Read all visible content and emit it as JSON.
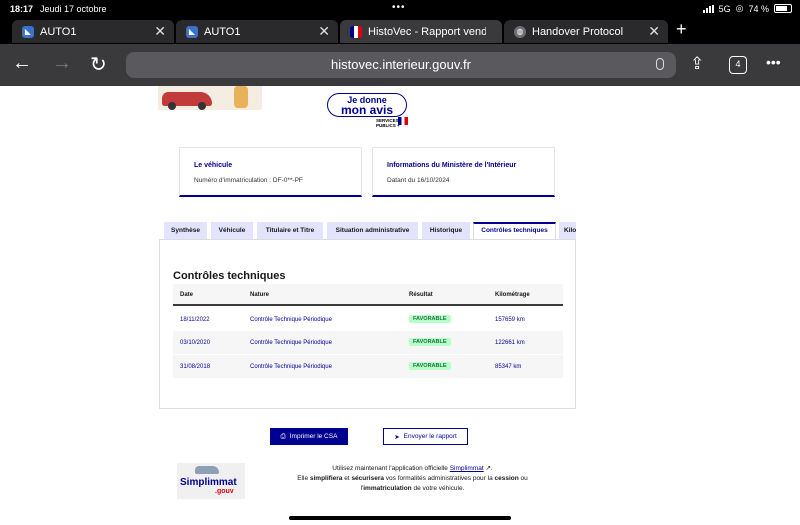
{
  "status": {
    "time": "18:17",
    "date": "Jeudi 17 octobre",
    "network": "5G",
    "battery": "74 %"
  },
  "browser_tabs": [
    {
      "title": "AUTO1",
      "icon": "auto1-favicon",
      "color": "#3b73c9"
    },
    {
      "title": "AUTO1",
      "icon": "auto1-favicon",
      "color": "#3b73c9"
    },
    {
      "title": "HistoVec - Rapport vendeur",
      "icon": "french-flag-favicon",
      "color": "#000091"
    },
    {
      "title": "Handover Protocol",
      "icon": "globe-icon",
      "color": "#6e6e73"
    }
  ],
  "toolbar": {
    "url": "histovec.interieur.gouv.fr",
    "tab_count": "4"
  },
  "banner": {
    "avis_line1": "Je donne",
    "avis_line2": "mon avis",
    "services_publics": "SERVICES PUBLICS +"
  },
  "cards": [
    {
      "title": "Le véhicule",
      "value": "Numéro d'immatriculation : DF-0**-PF"
    },
    {
      "title": "Informations du Ministère de l'Intérieur",
      "value": "Datant du 16/10/2024"
    }
  ],
  "page_tabs": [
    "Synthèse",
    "Véhicule",
    "Titulaire et Titre",
    "Situation administrative",
    "Historique",
    "Contrôles techniques",
    "Kilométrage"
  ],
  "active_tab": "Contrôles techniques",
  "section": {
    "title": "Contrôles techniques",
    "columns": [
      "Date",
      "Nature",
      "Résultat",
      "Kilométrage"
    ],
    "rows": [
      {
        "date": "18/11/2022",
        "nature": "Contrôle Technique Périodique",
        "result": "FAVORABLE",
        "km": "157659 km"
      },
      {
        "date": "03/10/2020",
        "nature": "Contrôle Technique Périodique",
        "result": "FAVORABLE",
        "km": "122661 km"
      },
      {
        "date": "31/08/2018",
        "nature": "Contrôle Technique Périodique",
        "result": "FAVORABLE",
        "km": "85347 km"
      }
    ]
  },
  "actions": {
    "print_label": "Imprimer le CSA",
    "send_label": "Envoyer le rapport"
  },
  "footer": {
    "logo_main": "Simplimmat",
    "logo_sub": ".gouv",
    "line1_pre": "Utilisez maintenant l'application officielle ",
    "line1_link": "Simplimmat",
    "line1_post": " ↗.",
    "line2_a": "Elle ",
    "line2_b": "simplifiera",
    "line2_c": " et ",
    "line2_d": "sécurisera",
    "line2_e": " vos formalités administratives pour la ",
    "line2_f": "cession",
    "line2_g": " ou",
    "line3_a": "l'",
    "line3_b": "immatriculation",
    "line3_c": " de votre véhicule."
  },
  "colors": {
    "primary": "#000091",
    "success_bg": "#b8fec9",
    "success_text": "#18753c"
  }
}
